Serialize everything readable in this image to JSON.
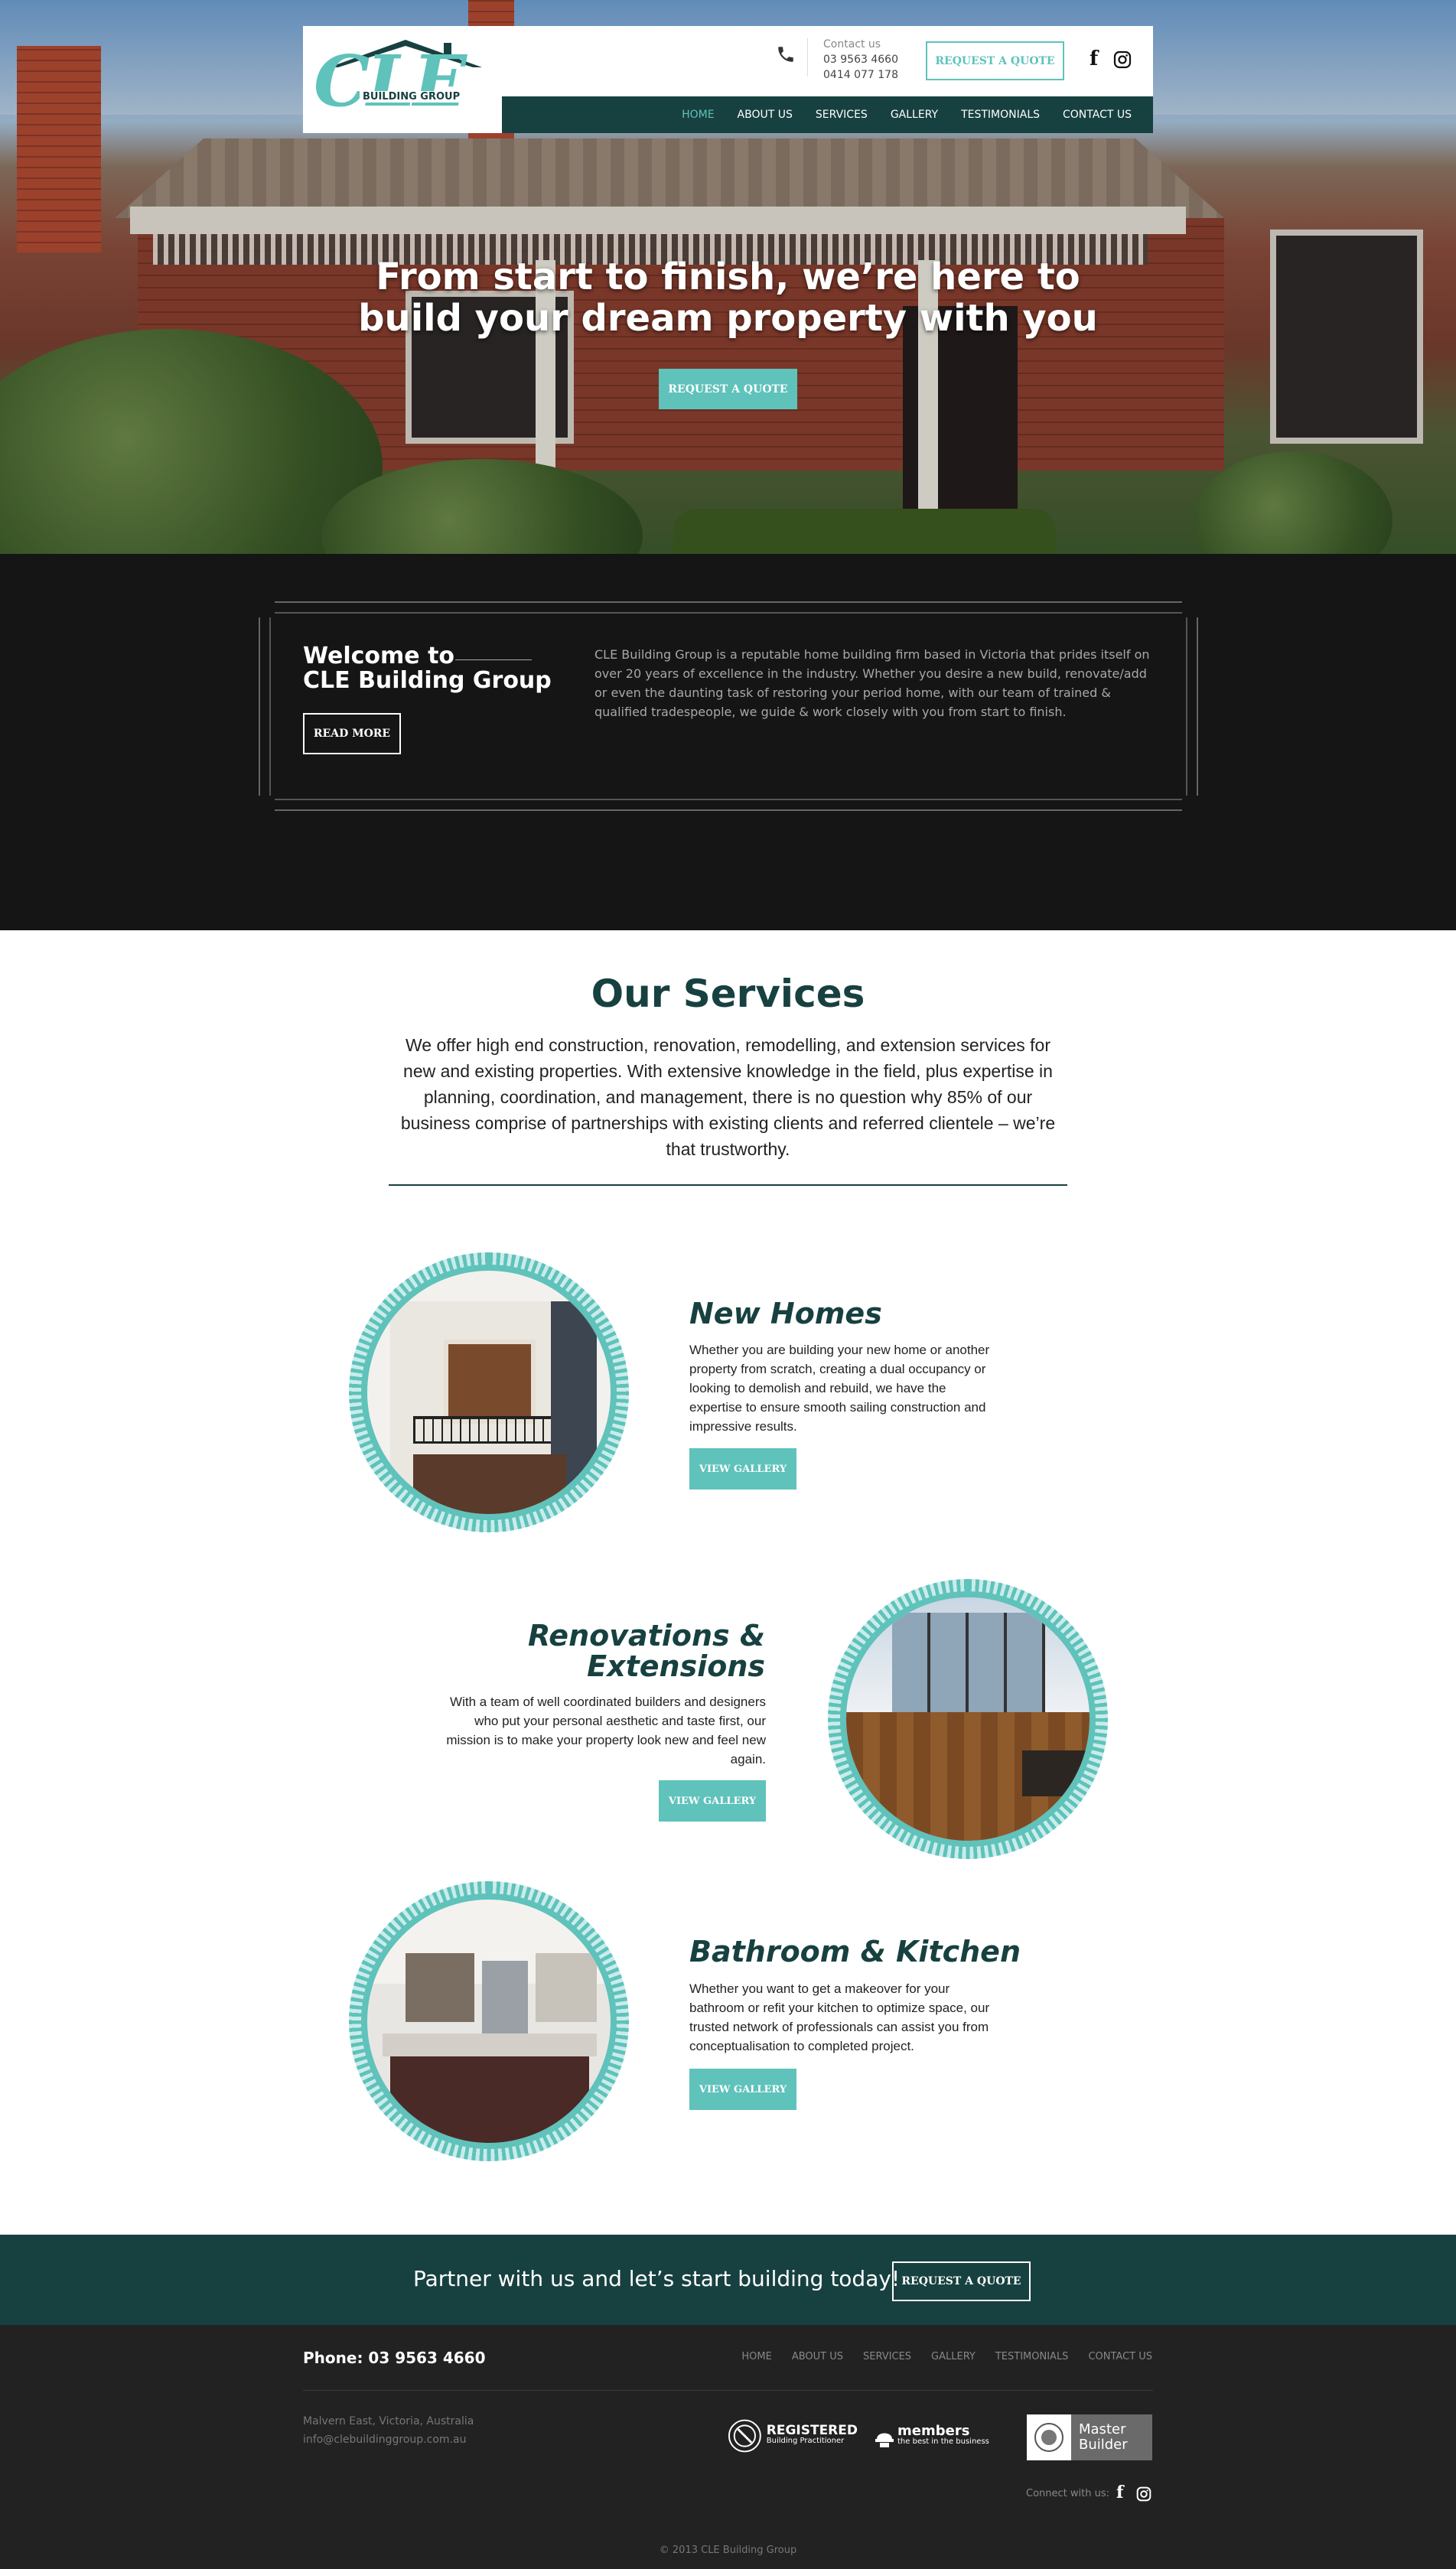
{
  "colors": {
    "accent": "#5fc2bb",
    "dark_teal": "#174140",
    "dark_bg": "#151515",
    "footer_bg": "#222222"
  },
  "logo": {
    "text": "CLE",
    "subtitle": "BUILDING GROUP"
  },
  "header": {
    "contact_label": "Contact us",
    "phone_1": "03 9563 4660",
    "phone_2": "0414 077 178",
    "quote_label": "REQUEST A QUOTE",
    "social": {
      "facebook_icon": "f"
    }
  },
  "nav": {
    "items": [
      {
        "label": "HOME",
        "active": true
      },
      {
        "label": "ABOUT US"
      },
      {
        "label": "SERVICES"
      },
      {
        "label": "GALLERY"
      },
      {
        "label": "TESTIMONIALS"
      },
      {
        "label": "CONTACT US"
      }
    ]
  },
  "hero": {
    "title_line1": "From start to finish, we’re here to",
    "title_line2": "build your dream property with you",
    "cta_label": "REQUEST A QUOTE"
  },
  "welcome": {
    "title_line1": "Welcome to",
    "title_line2": "CLE Building Group",
    "read_more": "READ MORE",
    "text": "CLE Building Group is a reputable home building firm based in Victoria that prides itself on over 20 years of excellence in the industry. Whether you desire a new build, renovate/add or even the daunting task of restoring your period home, with our team of trained & qualified tradespeople, we guide & work closely with you from start to finish."
  },
  "services": {
    "title": "Our Services",
    "intro": "We offer high end construction, renovation, remodelling, and extension services for new and existing properties. With extensive knowledge in the field, plus expertise in planning, coordination, and management, there is no question why 85% of our business comprise of partnerships with existing clients and referred clientele – we’re that trustworthy.",
    "items": [
      {
        "title": "New Homes",
        "text": "Whether you are building your new home or another property from scratch, creating a dual occupancy or looking to demolish and rebuild, we have the expertise to ensure smooth sailing construction and impressive results.",
        "button": "VIEW GALLERY"
      },
      {
        "title_line1": "Renovations &",
        "title_line2": "Extensions",
        "text": "With a team of well coordinated builders and designers who put your personal aesthetic and taste first, our mission is to make your property look new and feel new again.",
        "button": "VIEW GALLERY"
      },
      {
        "title": "Bathroom & Kitchen",
        "text": "Whether you want to get a makeover for your bathroom or refit your kitchen to optimize space, our trusted network of professionals can assist you from conceptualisation to completed project.",
        "button": "VIEW GALLERY"
      }
    ]
  },
  "partner": {
    "text": "Partner with us and let’s start building today!",
    "button": "REQUEST A QUOTE"
  },
  "footer": {
    "phone": "Phone: 03 9563 4660",
    "nav": [
      "HOME",
      "ABOUT US",
      "SERVICES",
      "GALLERY",
      "TESTIMONIALS",
      "CONTACT US"
    ],
    "address": "Malvern East, Victoria, Australia",
    "email": "info@clebuildinggroup.com.au",
    "badges": {
      "registered_title": "REGISTERED",
      "registered_sub": "Building Practitioner",
      "members_title": "members",
      "members_sub": "the best in the business",
      "master_line1": "Master",
      "master_line2": "Builder"
    },
    "connect": "Connect with us:",
    "copyright": "© 2013 CLE Building Group"
  }
}
